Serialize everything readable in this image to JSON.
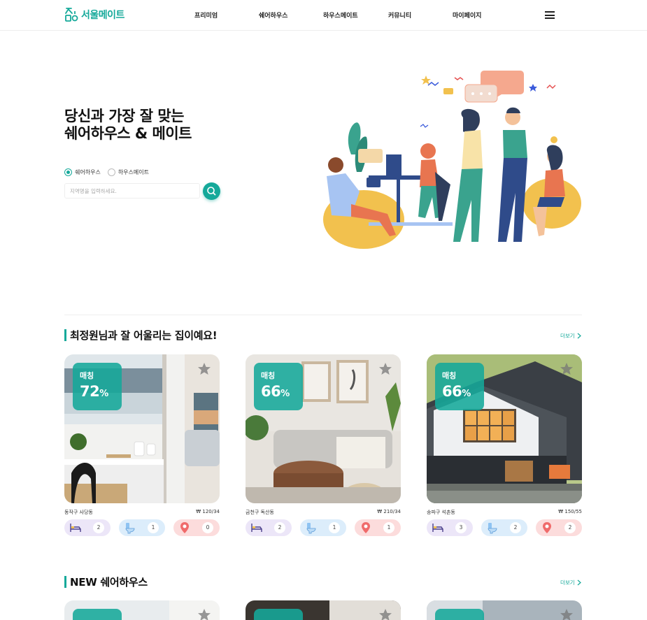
{
  "header": {
    "logo_text": "서울메이트",
    "nav": [
      "프리미엄",
      "쉐어하우스",
      "하우스메이트",
      "커뮤니티",
      "마이페이지"
    ]
  },
  "hero": {
    "title": "당신과 가장 잘 맞는\n쉐어하우스 & 메이트",
    "radio_options": [
      "쉐어하우스",
      "하우스메이트"
    ],
    "selected_option": "쉐어하우스",
    "search_placeholder": "지역명을 입력하세요."
  },
  "sections": [
    {
      "title": "최정원님과 잘 어울리는 집이예요!",
      "more": "더보기",
      "cards": [
        {
          "match_label": "매칭",
          "match_value": "72",
          "match_unit": "%",
          "location": "동작구 사당동",
          "price": "₩ 120/34",
          "rooms": "2",
          "baths": "1",
          "spots": "0"
        },
        {
          "match_label": "매칭",
          "match_value": "66",
          "match_unit": "%",
          "location": "금천구 독산동",
          "price": "₩ 210/34",
          "rooms": "2",
          "baths": "1",
          "spots": "1"
        },
        {
          "match_label": "매칭",
          "match_value": "66",
          "match_unit": "%",
          "location": "송파구 석촌동",
          "price": "₩ 150/55",
          "rooms": "3",
          "baths": "2",
          "spots": "2"
        }
      ]
    },
    {
      "title": "NEW 쉐어하우스",
      "more": "더보기"
    }
  ],
  "colors": {
    "accent": "#15a99a",
    "bed_pill": "#ece6f8",
    "bath_pill": "#dcedfb",
    "loc_pill": "#fcdcdc"
  },
  "icons": [
    "hamburger-menu-icon",
    "search-icon",
    "star-icon",
    "bed-icon",
    "toilet-icon",
    "location-pin-icon",
    "chevron-right-icon"
  ]
}
